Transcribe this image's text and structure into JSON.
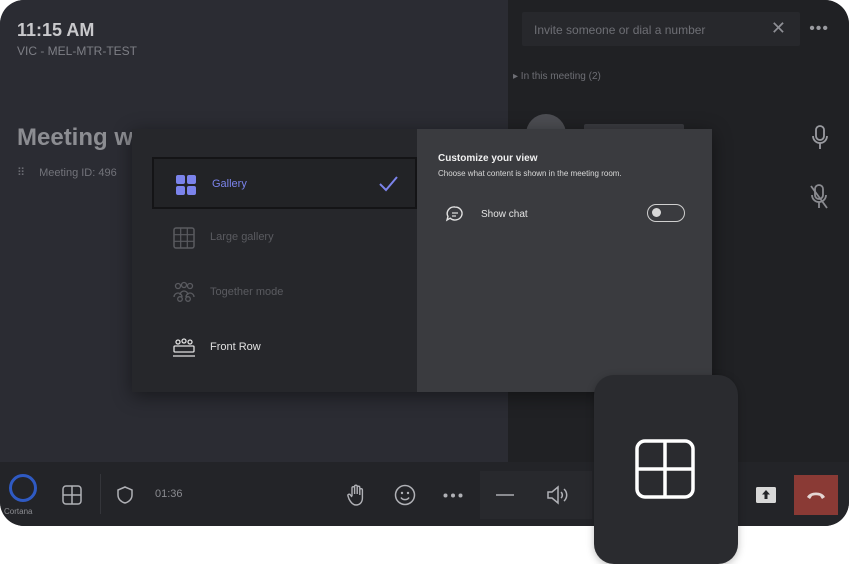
{
  "status": {
    "time": "11:15 AM",
    "room_name": "VIC - MEL-MTR-TEST"
  },
  "meeting": {
    "title": "Meeting w",
    "id_text": "Meeting ID: 496"
  },
  "sidebar": {
    "invite_placeholder": "Invite someone or dial a number",
    "close_symbol": "✕",
    "more_symbol": "•••",
    "in_meeting_label": "▸ In this meeting (2)"
  },
  "layout_menu": {
    "options": [
      {
        "label": "Gallery",
        "icon": "gallery-icon",
        "state": "selected",
        "color": "#7b83eb"
      },
      {
        "label": "Large gallery",
        "icon": "large-gallery-icon",
        "state": "disabled",
        "color": "#5a5b60"
      },
      {
        "label": "Together mode",
        "icon": "together-mode-icon",
        "state": "disabled",
        "color": "#5a5b60"
      },
      {
        "label": "Front Row",
        "icon": "front-row-icon",
        "state": "enabled",
        "color": "#e0e0e0"
      }
    ]
  },
  "customize": {
    "title": "Customize your view",
    "subtitle": "Choose what content is shown in the meeting room.",
    "show_chat_label": "Show chat",
    "show_chat_enabled": false
  },
  "toolbar": {
    "cortana_label": "Cortana",
    "duration": "01:36",
    "hangup_color": "#8a3a35"
  },
  "colors": {
    "accent": "#7b83eb",
    "cortana_ring": "#2f5ac3"
  }
}
